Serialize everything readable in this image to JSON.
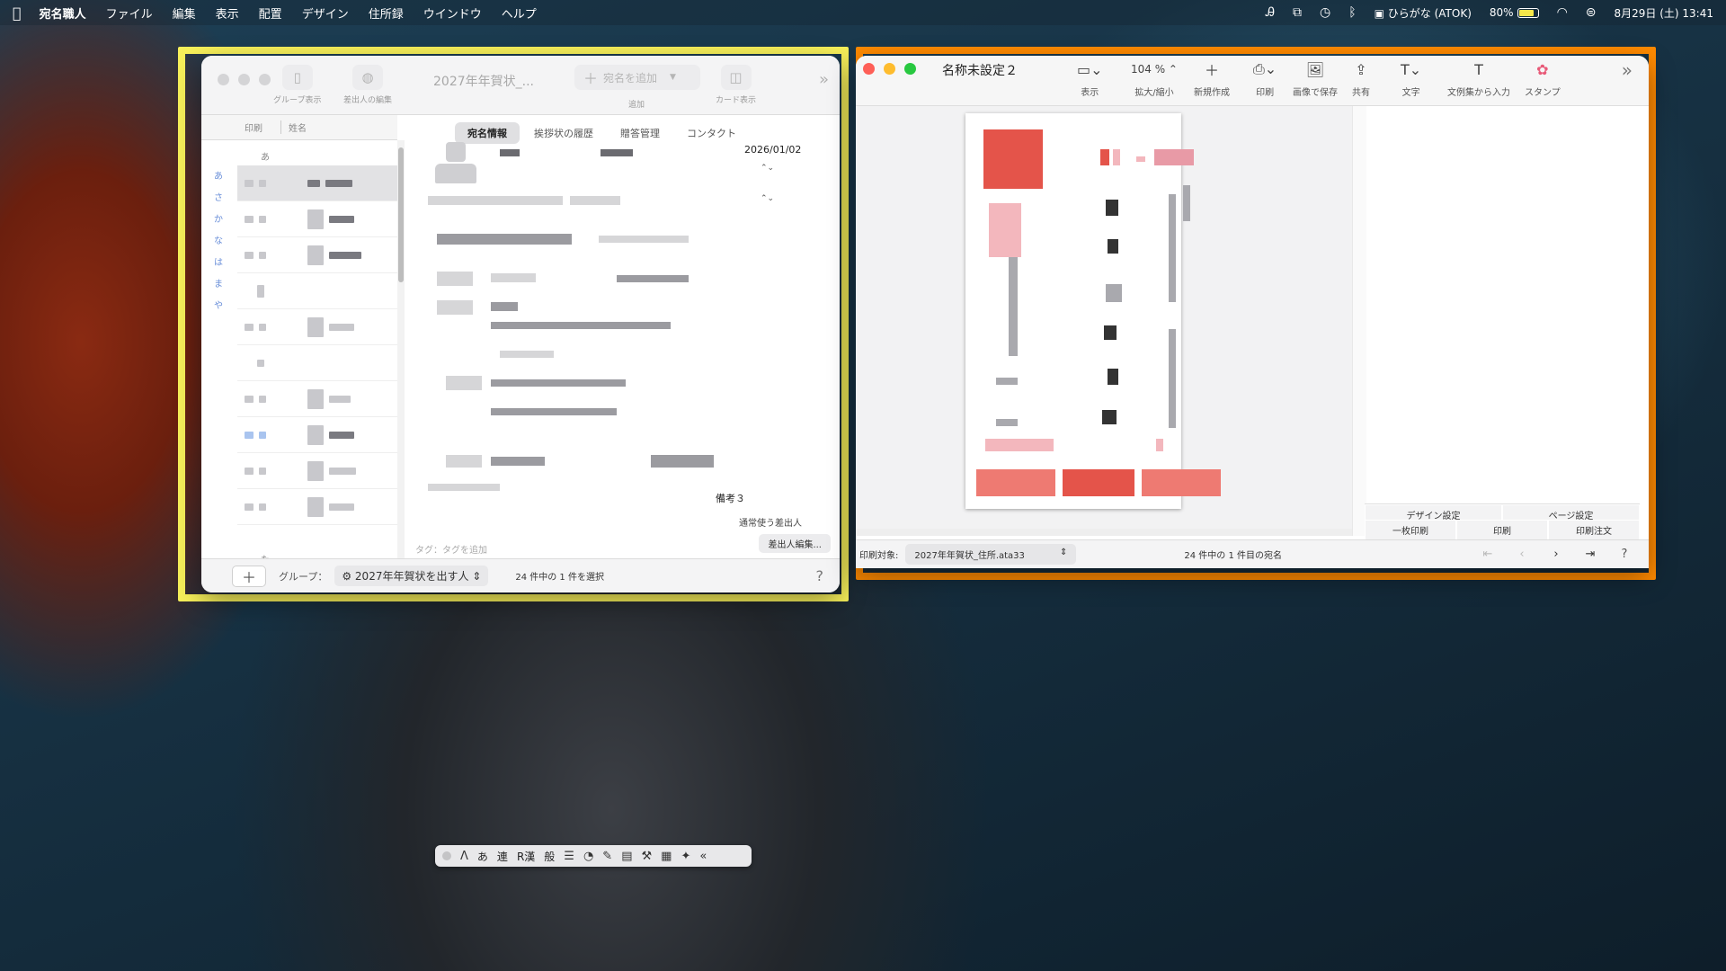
{
  "menubar": {
    "app_name": "宛名職人",
    "items": [
      "ファイル",
      "編集",
      "表示",
      "配置",
      "デザイン",
      "住所録",
      "ウインドウ",
      "ヘルプ"
    ],
    "input_mode": "ひらがな (ATOK)",
    "battery": "80%",
    "battery_level": 0.8,
    "datetime": "8月29日 (土)  13:41"
  },
  "left_window": {
    "title": "2027年年賀状_...",
    "toolbar": {
      "group_view": "グループ表示",
      "sender_edit": "差出人の編集",
      "add_recipient": "宛名を追加",
      "add_caption": "追加",
      "card_view": "カード表示"
    },
    "list_headers": {
      "print": "印刷",
      "name": "姓名"
    },
    "kana_index": [
      "あ",
      "さ",
      "か",
      "な",
      "は",
      "ま",
      "や"
    ],
    "group_heads": {
      "first": "あ",
      "last": "た"
    },
    "tabs": [
      "宛名情報",
      "挨拶状の履歴",
      "贈答管理",
      "コンタクト"
    ],
    "date": "2026/01/02",
    "note_label": "備考３",
    "usual_sender": "通常使う差出人",
    "tag_prompt": "タグ：タグを追加",
    "sender_edit_button": "差出人編集...",
    "status": {
      "plus": "＋",
      "group_label": "グループ：",
      "group_value": "2027年年賀状を出す人",
      "count": "24 件中の 1 件を選択",
      "help": "?"
    }
  },
  "right_window": {
    "title": "名称未設定２",
    "toolbar": [
      {
        "icon": "display-icon",
        "glyph": "▭⌄",
        "label": "表示"
      },
      {
        "icon": "zoom-icon",
        "glyph": "104 % ⌃",
        "label": "拡大/縮小"
      },
      {
        "icon": "plus-icon",
        "glyph": "＋",
        "label": "新規作成"
      },
      {
        "icon": "printer-icon",
        "glyph": "⎙⌄",
        "label": "印刷"
      },
      {
        "icon": "image-icon",
        "glyph": "🖼",
        "label": "画像で保存"
      },
      {
        "icon": "share-icon",
        "glyph": "⇪",
        "label": "共有"
      },
      {
        "icon": "text-icon",
        "glyph": "T⌄",
        "label": "文字"
      },
      {
        "icon": "template-text-icon",
        "glyph": "T",
        "label": "文例集から入力"
      },
      {
        "icon": "stamp-icon",
        "glyph": "✿",
        "label": "スタンプ"
      }
    ],
    "side_buttons": [
      "デザイン設定",
      "ページ設定"
    ],
    "side_buttons2": [
      "一枚印刷",
      "印刷",
      "印刷注文"
    ],
    "status": {
      "target_label": "印刷対象:",
      "target_value": "2027年年賀状_住所.ata33",
      "count": "24 件中の 1 件目の宛名",
      "help": "?"
    }
  },
  "ime_palette": {
    "mode": "あ",
    "conv": "連",
    "kanji": "R漢",
    "general": "般"
  },
  "colors": {
    "yellow_highlight": "#f7f05a",
    "orange_highlight": "#ff8a00",
    "stamp_red": "#e4544a"
  }
}
